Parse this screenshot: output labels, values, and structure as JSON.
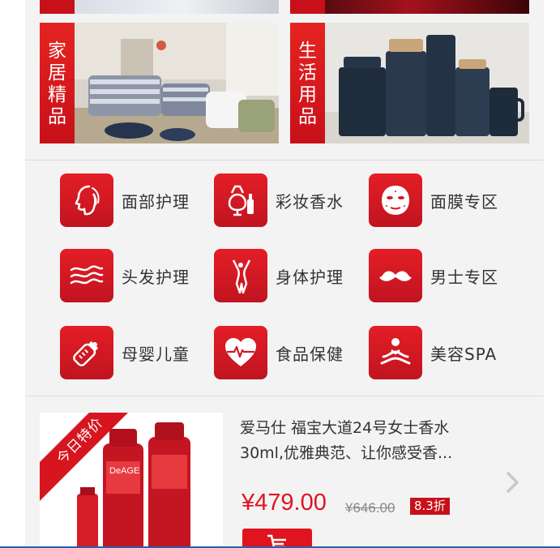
{
  "banners": {
    "home": {
      "label": "家居精品"
    },
    "life": {
      "label": "生活用品"
    }
  },
  "categories": [
    {
      "label": "面部护理",
      "icon": "face-icon"
    },
    {
      "label": "彩妆香水",
      "icon": "perfume-icon"
    },
    {
      "label": "面膜专区",
      "icon": "mask-icon"
    },
    {
      "label": "头发护理",
      "icon": "hair-icon"
    },
    {
      "label": "身体护理",
      "icon": "body-icon"
    },
    {
      "label": "男士专区",
      "icon": "mustache-icon"
    },
    {
      "label": "母婴儿童",
      "icon": "baby-bottle-icon"
    },
    {
      "label": "食品保健",
      "icon": "heart-pulse-icon"
    },
    {
      "label": "美容SPA",
      "icon": "spa-icon"
    }
  ],
  "product": {
    "ribbon": "今日特价",
    "title_line1": "爱马仕 福宝大道24号女士香水",
    "title_line2": "30ml,优雅典范、让你感受香...",
    "price": "¥479.00",
    "old_price": "¥646.00",
    "discount": "8.3折",
    "brand_text": "DeAGE"
  },
  "colors": {
    "accent": "#d7151f",
    "background": "#f3f3f3"
  }
}
